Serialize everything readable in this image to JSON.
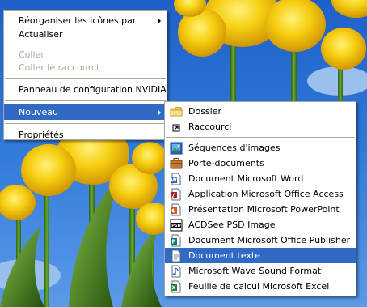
{
  "context_menu": {
    "items": [
      {
        "label": "Réorganiser les icônes par",
        "has_submenu": true
      },
      {
        "label": "Actualiser"
      },
      {
        "label": "Coller",
        "disabled": true
      },
      {
        "label": "Coller le raccourci",
        "disabled": true
      },
      {
        "label": "Panneau de configuration NVIDIA"
      },
      {
        "label": "Nouveau",
        "has_submenu": true,
        "selected": true
      },
      {
        "label": "Propriétés"
      }
    ]
  },
  "new_submenu": {
    "items": [
      {
        "label": "Dossier",
        "icon": "folder-icon"
      },
      {
        "label": "Raccourci",
        "icon": "shortcut-icon"
      },
      {
        "label": "Séquences d'images",
        "icon": "image-sequence-icon"
      },
      {
        "label": "Porte-documents",
        "icon": "briefcase-icon"
      },
      {
        "label": "Document Microsoft Word",
        "icon": "word-document-icon"
      },
      {
        "label": "Application Microsoft Office Access",
        "icon": "access-application-icon"
      },
      {
        "label": "Présentation Microsoft PowerPoint",
        "icon": "powerpoint-presentation-icon"
      },
      {
        "label": "ACDSee PSD Image",
        "icon": "psd-image-icon"
      },
      {
        "label": "Document Microsoft Office Publisher",
        "icon": "publisher-document-icon"
      },
      {
        "label": "Document texte",
        "icon": "text-document-icon",
        "selected": true
      },
      {
        "label": "Microsoft Wave Sound Format",
        "icon": "wave-sound-icon"
      },
      {
        "label": "Feuille de calcul Microsoft Excel",
        "icon": "excel-spreadsheet-icon"
      }
    ]
  },
  "colors": {
    "menu_highlight": "#316ac5",
    "disabled_text": "#aca899",
    "sky": "#2f78d8",
    "tulip": "#f2c40c",
    "stem": "#3d7a1e"
  }
}
